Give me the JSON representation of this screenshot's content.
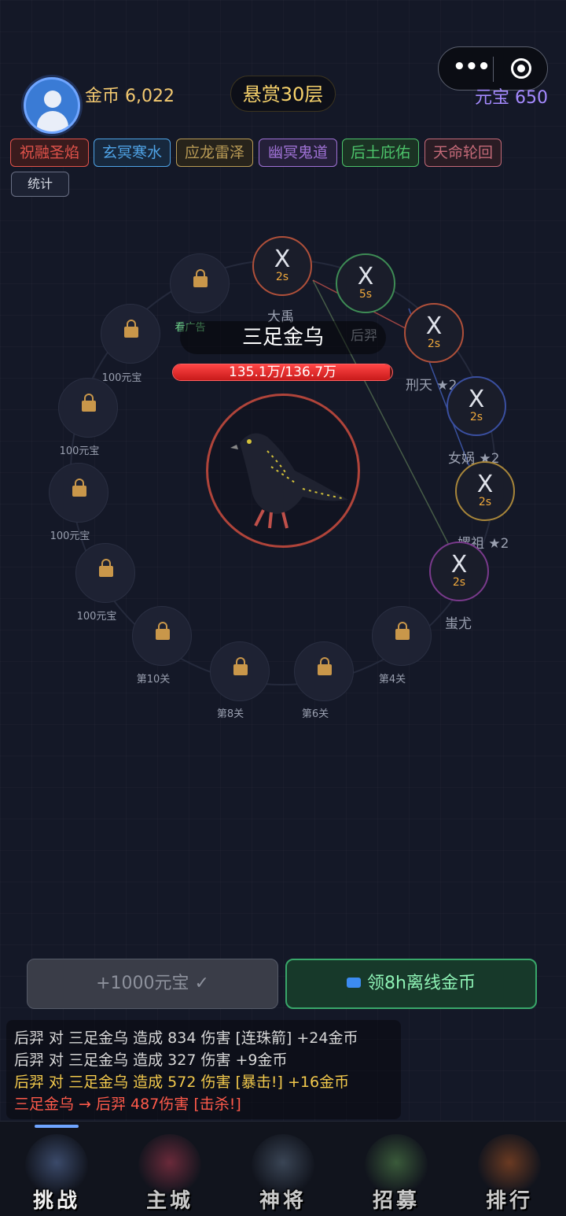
{
  "header": {
    "gold_label": "金币 6,022",
    "reward_label": "悬赏30层",
    "yuanbao_label": "元宝 650",
    "menu_icon": "more-dots-icon",
    "close_icon": "target-circle-icon"
  },
  "elements": [
    {
      "label": "祝融圣焰",
      "color": "#e0524a",
      "bg": "#3a1b1d"
    },
    {
      "label": "玄冥寒水",
      "color": "#4fa3e6",
      "bg": "#17283d"
    },
    {
      "label": "应龙雷泽",
      "color": "#b89a55",
      "bg": "#27231b"
    },
    {
      "label": "幽冥鬼道",
      "color": "#a072d6",
      "bg": "#25203a"
    },
    {
      "label": "后土庇佑",
      "color": "#4cc36a",
      "bg": "#1b3324"
    },
    {
      "label": "天命轮回",
      "color": "#c46a78",
      "bg": "#2a1c24"
    }
  ],
  "stats_label": "统计",
  "locked_slots": [
    {
      "label": "看广告",
      "accent": "#6fd48b"
    },
    {
      "label": "100元宝"
    },
    {
      "label": "100元宝"
    },
    {
      "label": "100元宝"
    },
    {
      "label": "100元宝"
    },
    {
      "label": "第10关"
    },
    {
      "label": "第8关"
    },
    {
      "label": "第6关"
    },
    {
      "label": "第4关"
    }
  ],
  "heroes": [
    {
      "name": "大禹",
      "cooldown": "2s",
      "mark": "X",
      "ring_color": "#b0503a"
    },
    {
      "name": "后羿",
      "cooldown": "5s",
      "mark": "X",
      "ring_color": "#3e8c55"
    },
    {
      "name": "刑天 ★2",
      "cooldown": "2s",
      "mark": "X",
      "ring_color": "#b0503a"
    },
    {
      "name": "女娲 ★2",
      "cooldown": "2s",
      "mark": "X",
      "ring_color": "#3a4fa0"
    },
    {
      "name": "嫘祖 ★2",
      "cooldown": "2s",
      "mark": "X",
      "ring_color": "#a8863a"
    },
    {
      "name": "蚩尤",
      "cooldown": "2s",
      "mark": "X",
      "ring_color": "#7a3a8c"
    }
  ],
  "boss": {
    "name": "三足金乌",
    "hp_text": "135.1万/136.7万",
    "hp_current": 135.1,
    "hp_max": 136.7
  },
  "buttons": {
    "yuanbao_claim": "+1000元宝 ✓",
    "offline_gold": "领8h离线金币"
  },
  "combat_log": [
    {
      "text": "后羿 对 三足金乌 造成 834 伤害 [连珠箭] +24金币",
      "color": "#d8d8d8"
    },
    {
      "text": "后羿 对 三足金乌 造成 327 伤害  +9金币",
      "color": "#d8d8d8"
    },
    {
      "text": "后羿 对 三足金乌 造成 572 伤害 [暴击!] +16金币",
      "color": "#f2c94c"
    },
    {
      "text": "三足金乌 → 后羿 487伤害 [击杀!]",
      "color": "#ff5a4a"
    }
  ],
  "nav": [
    {
      "label": "挑战",
      "icon": "archer-hero-icon",
      "active": true
    },
    {
      "label": "主城",
      "icon": "scroll-gate-icon",
      "active": false
    },
    {
      "label": "神将",
      "icon": "armor-robe-icon",
      "active": false
    },
    {
      "label": "招募",
      "icon": "gourd-icon",
      "active": false
    },
    {
      "label": "排行",
      "icon": "treasure-bag-icon",
      "active": false
    }
  ]
}
